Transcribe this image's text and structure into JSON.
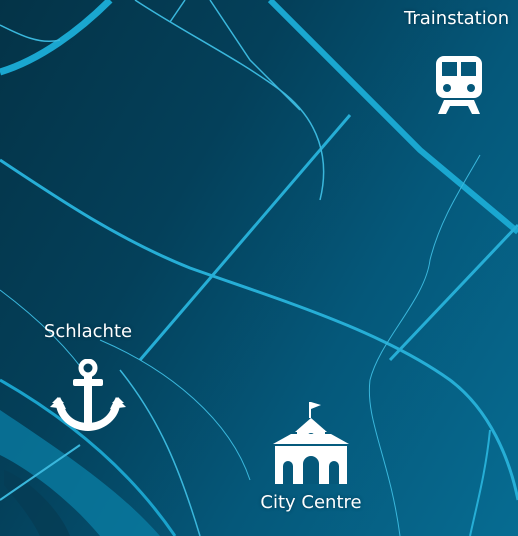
{
  "map": {
    "colors": {
      "background_dark": "#043347",
      "background_light": "#066c92",
      "road_major": "#1a9fc6",
      "road_minor": "#3fb6d9",
      "river": "#0a86ad",
      "label": "#ffffff"
    }
  },
  "pois": {
    "train": {
      "label": "Trainstation",
      "icon": "train-icon"
    },
    "schlachte": {
      "label": "Schlachte",
      "icon": "anchor-icon"
    },
    "city": {
      "label": "City Centre",
      "icon": "town-hall-icon"
    }
  }
}
